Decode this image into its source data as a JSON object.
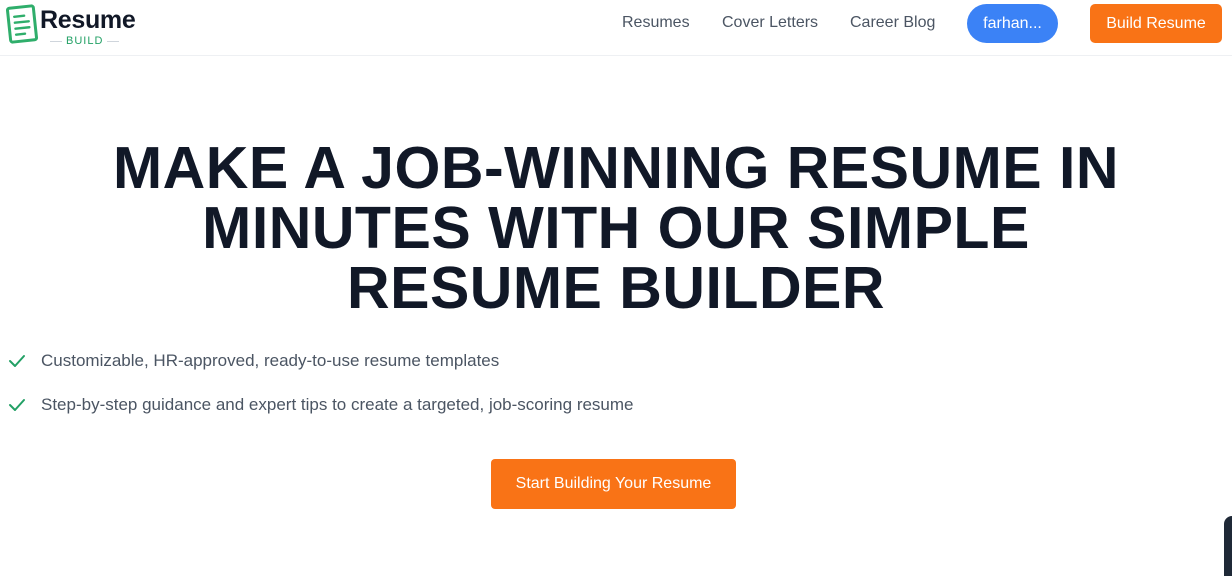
{
  "header": {
    "logo": {
      "title": "Resume",
      "subtitle": "BUILD"
    },
    "nav": [
      {
        "label": "Resumes"
      },
      {
        "label": "Cover Letters"
      },
      {
        "label": "Career Blog"
      }
    ],
    "user": {
      "label": "farhan..."
    },
    "build_button": {
      "label": "Build Resume"
    }
  },
  "hero": {
    "title_lines": [
      "MAKE A JOB-WINNING RESUME IN",
      "MINUTES WITH OUR SIMPLE",
      "RESUME BUILDER"
    ],
    "features": [
      {
        "text": "Customizable, HR-approved, ready-to-use resume templates",
        "icon": "check-icon"
      },
      {
        "text": "Step-by-step guidance and expert tips to create a targeted, job-scoring resume",
        "icon": "check-icon"
      }
    ],
    "cta": {
      "label": "Start Building Your Resume"
    }
  },
  "colors": {
    "accent_orange": "#f97316",
    "user_blue": "#3b82f6",
    "check_green": "#22a065",
    "heading_dark": "#111827",
    "body_gray": "#4b5563"
  }
}
